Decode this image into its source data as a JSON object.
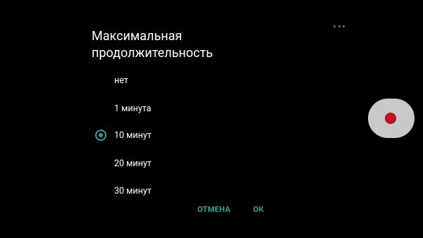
{
  "dialog": {
    "title": "Максимальная\nпродолжительность",
    "options": [
      {
        "label": "нет",
        "selected": false
      },
      {
        "label": "1 минута",
        "selected": false
      },
      {
        "label": "10 минут",
        "selected": true
      },
      {
        "label": "20 минут",
        "selected": false
      },
      {
        "label": "30 минут",
        "selected": false
      }
    ],
    "cancel_label": "ОТМЕНА",
    "ok_label": "ОК"
  },
  "icons": {
    "overflow_menu": "more-horizontal-icon",
    "record_button": "record-icon"
  },
  "colors": {
    "background": "#000000",
    "accent": "#26a69a",
    "record_pill": "#c9c9c9",
    "record_dot": "#c4161c"
  }
}
